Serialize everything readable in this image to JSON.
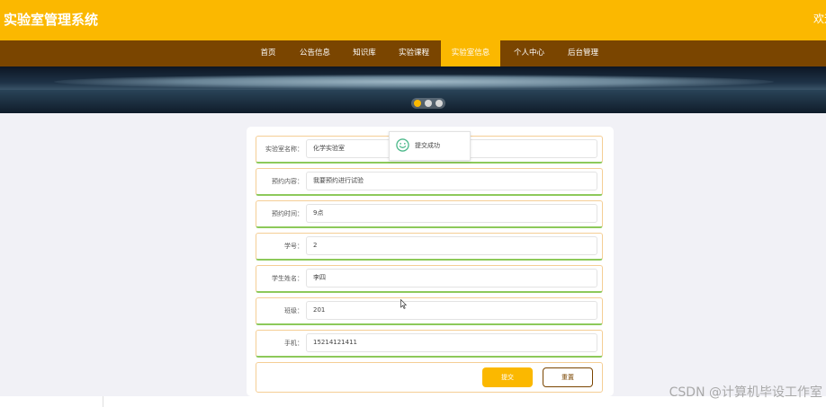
{
  "header": {
    "title": "实验室管理系统",
    "welcome": "欢迎"
  },
  "nav": {
    "items": [
      {
        "label": "首页"
      },
      {
        "label": "公告信息"
      },
      {
        "label": "知识库"
      },
      {
        "label": "实验课程"
      },
      {
        "label": "实验室信息",
        "active": true
      },
      {
        "label": "个人中心"
      },
      {
        "label": "后台管理"
      }
    ]
  },
  "banner": {
    "slides": 3,
    "active_slide": 1
  },
  "form": {
    "fields": [
      {
        "label": "实验室名称：",
        "value": "化学实验室"
      },
      {
        "label": "预约内容：",
        "value": "我要预约进行试验"
      },
      {
        "label": "预约时间：",
        "value": "9点"
      },
      {
        "label": "学号：",
        "value": "2"
      },
      {
        "label": "学生姓名：",
        "value": "李四"
      },
      {
        "label": "班级：",
        "value": "201"
      },
      {
        "label": "手机：",
        "value": "15214121411"
      }
    ],
    "submit_label": "提交",
    "reset_label": "重置"
  },
  "toast": {
    "text": "提交成功",
    "icon": "smile-icon"
  },
  "watermark": "CSDN @计算机毕设工作室",
  "colors": {
    "accent": "#fbb800",
    "nav_bg": "#7a4500",
    "field_border": "#8dc95a"
  }
}
